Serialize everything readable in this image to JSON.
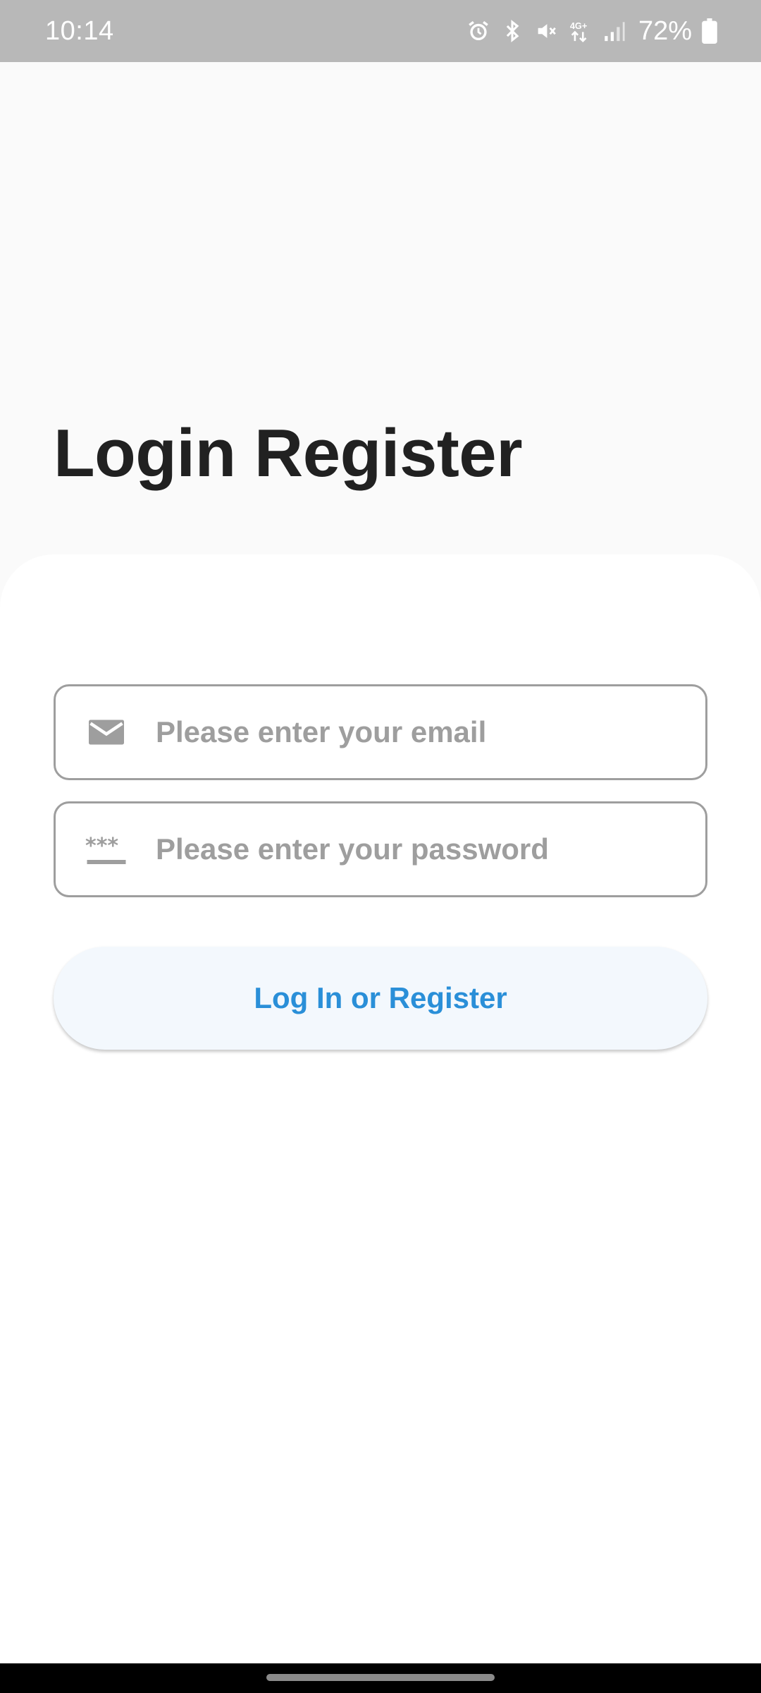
{
  "status_bar": {
    "time": "10:14",
    "battery": "72%",
    "icons": [
      "alarm-icon",
      "bluetooth-icon",
      "mute-icon",
      "network-4g-icon",
      "signal-icon",
      "battery-icon"
    ]
  },
  "title": "Login Register",
  "email": {
    "placeholder": "Please enter your email",
    "icon": "email-icon"
  },
  "password": {
    "placeholder": "Please enter your password",
    "icon": "password-icon"
  },
  "button": {
    "label": "Log In or Register"
  },
  "colors": {
    "accent": "#2a8fd8",
    "button_bg": "#f3f8fd",
    "title": "#212121",
    "placeholder": "#9e9e9e",
    "status_bar": "#b8b8b8"
  }
}
